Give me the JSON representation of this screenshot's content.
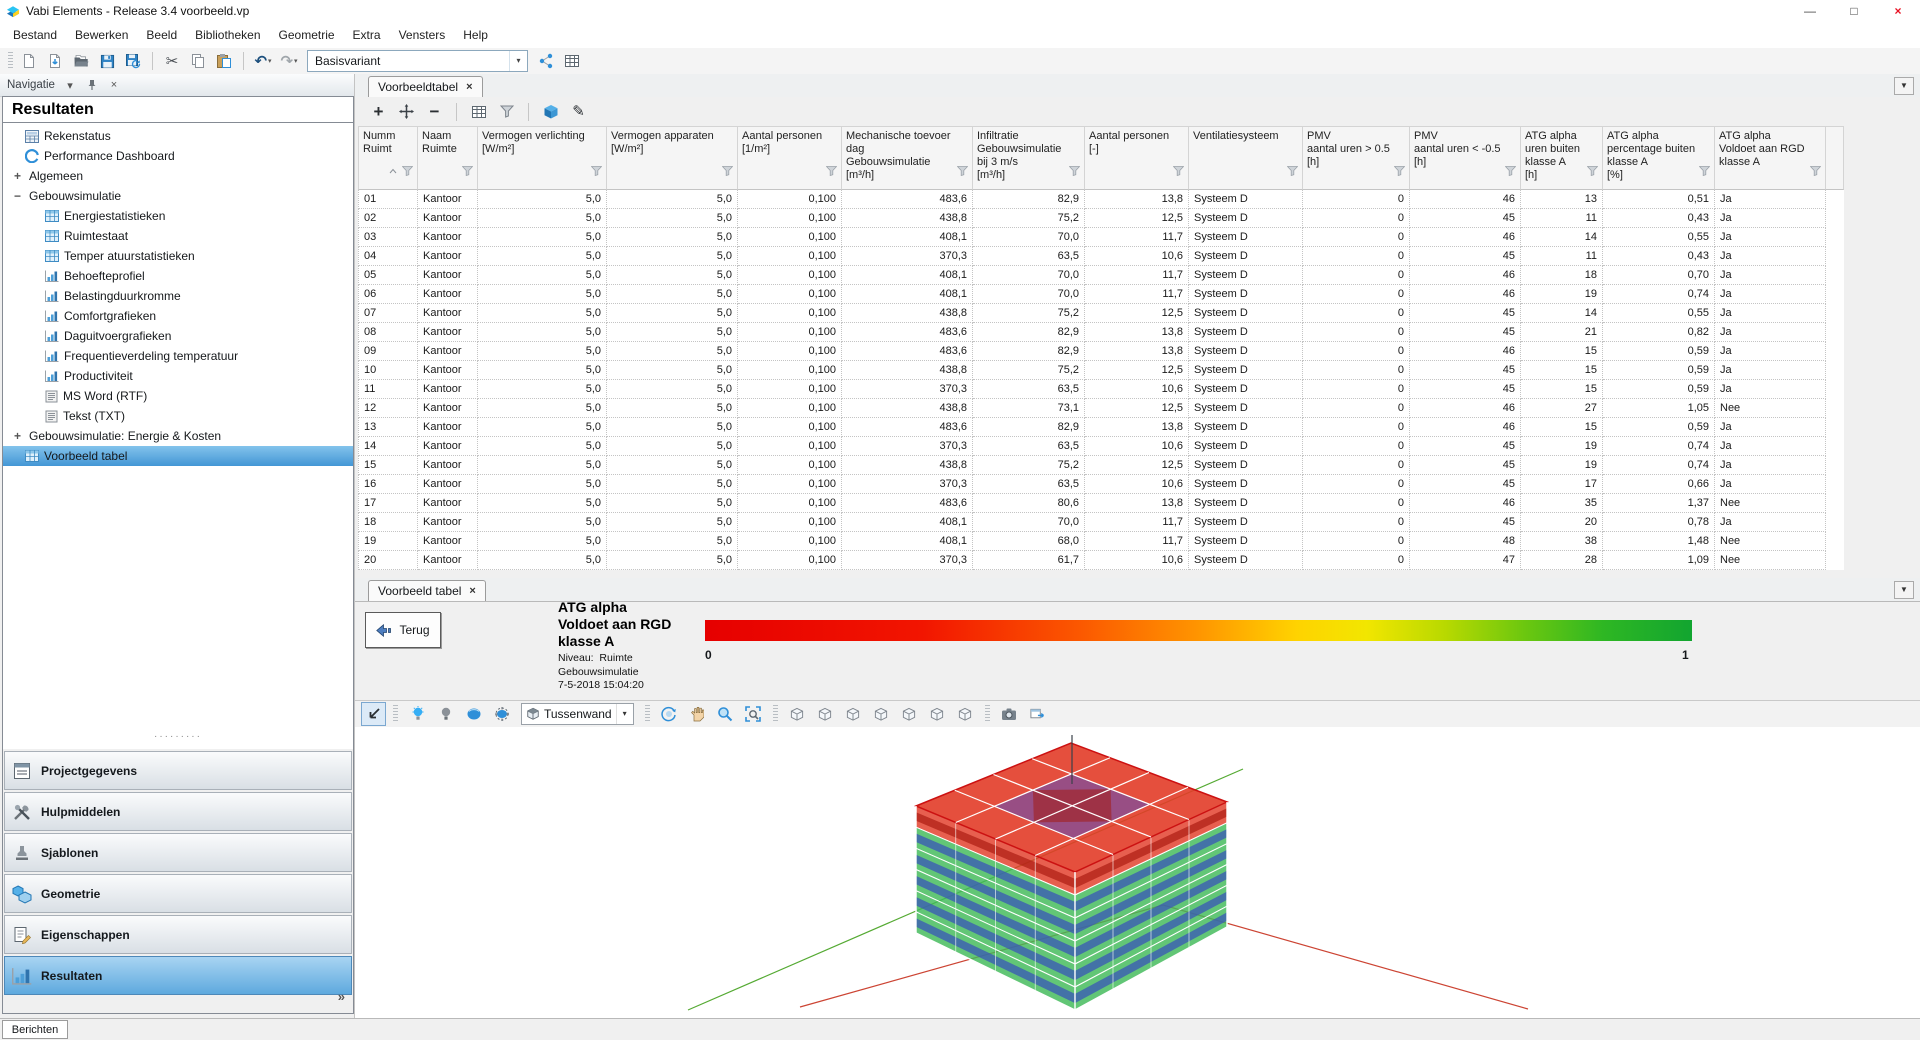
{
  "window": {
    "title": "Vabi Elements - Release 3.4 voorbeeld.vp"
  },
  "window_controls": {
    "minimize": "—",
    "maximize": "□",
    "close": "×"
  },
  "menu": {
    "items": [
      "Bestand",
      "Bewerken",
      "Beeld",
      "Bibliotheken",
      "Geometrie",
      "Extra",
      "Vensters",
      "Help"
    ]
  },
  "toolbar": {
    "buttons": [
      {
        "icon": "new-file"
      },
      {
        "icon": "import-file"
      },
      {
        "icon": "open-folder"
      },
      {
        "icon": "save"
      },
      {
        "icon": "save-refresh"
      },
      {
        "sep": true
      },
      {
        "icon": "cut"
      },
      {
        "icon": "copy"
      },
      {
        "icon": "paste"
      },
      {
        "sep": true
      },
      {
        "icon": "undo",
        "dropdown": true
      },
      {
        "icon": "redo",
        "dropdown": true
      }
    ],
    "variant_value": "Basisvariant",
    "right_buttons": [
      {
        "icon": "share"
      },
      {
        "icon": "table-tool"
      }
    ]
  },
  "sidebar": {
    "panel_title": "Navigatie",
    "section_title": "Resultaten",
    "tree": [
      {
        "label": "Rekenstatus",
        "icon": "calc",
        "indent": 1
      },
      {
        "label": "Performance Dashboard",
        "icon": "gauge",
        "indent": 1
      },
      {
        "label": "Algemeen",
        "expander": "+",
        "indent": 0
      },
      {
        "label": "Gebouwsimulatie",
        "expander": "−",
        "indent": 0
      },
      {
        "label": "Energiestatistieken",
        "icon": "tree-table",
        "indent": 2
      },
      {
        "label": "Ruimtestaat",
        "icon": "tree-table",
        "indent": 2
      },
      {
        "label": "Temper atuurstatistieken",
        "icon": "tree-table",
        "indent": 2
      },
      {
        "label": "Behoefteprofiel",
        "icon": "tree-chart",
        "indent": 2
      },
      {
        "label": "Belastingduurkromme",
        "icon": "tree-chart",
        "indent": 2
      },
      {
        "label": "Comfortgrafieken",
        "icon": "tree-chart",
        "indent": 2
      },
      {
        "label": "Daguitvoergrafieken",
        "icon": "tree-chart",
        "indent": 2
      },
      {
        "label": "Frequentieverdeling temperatuur",
        "icon": "tree-chart",
        "indent": 2
      },
      {
        "label": "Productiviteit",
        "icon": "tree-chart",
        "indent": 2
      },
      {
        "label": "MS Word (RTF)",
        "icon": "tree-doc",
        "indent": 2
      },
      {
        "label": "Tekst (TXT)",
        "icon": "tree-doc",
        "indent": 2
      },
      {
        "label": "Gebouwsimulatie: Energie &  Kosten",
        "expander": "+",
        "indent": 0
      },
      {
        "label": "Voorbeeld tabel",
        "icon": "tree-table",
        "indent": 1,
        "selected": true
      }
    ],
    "nav_buttons": [
      {
        "label": "Projectgegevens",
        "icon": "form"
      },
      {
        "label": "Hulpmiddelen",
        "icon": "tools"
      },
      {
        "label": "Sjablonen",
        "icon": "stamp"
      },
      {
        "label": "Geometrie",
        "icon": "geometry"
      },
      {
        "label": "Eigenschappen",
        "icon": "properties"
      },
      {
        "label": "Resultaten",
        "icon": "results-chart",
        "active": true
      }
    ]
  },
  "table_view": {
    "tab_label": "Voorbeeldtabel",
    "toolbar": [
      {
        "icon": "add"
      },
      {
        "icon": "fit"
      },
      {
        "icon": "remove"
      },
      {
        "sep": true
      },
      {
        "icon": "table-grid"
      },
      {
        "icon": "filter-funnel"
      },
      {
        "sep": true
      },
      {
        "icon": "cube-3d"
      },
      {
        "icon": "edit-pencil"
      }
    ],
    "columns": [
      {
        "lines": [
          "Numm",
          "Ruimt"
        ]
      },
      {
        "lines": [
          "Naam",
          "Ruimte"
        ]
      },
      {
        "lines": [
          "Vermogen verlichting",
          "[W/m²]"
        ]
      },
      {
        "lines": [
          "Vermogen apparaten",
          "[W/m²]"
        ]
      },
      {
        "lines": [
          "Aantal personen",
          "[1/m²]"
        ]
      },
      {
        "lines": [
          "Mechanische toevoer",
          "dag",
          "Gebouwsimulatie",
          "[m³/h]"
        ]
      },
      {
        "lines": [
          "Infiltratie",
          "Gebouwsimulatie",
          "bij 3 m/s",
          "[m³/h]"
        ]
      },
      {
        "lines": [
          "Aantal personen",
          "[-]"
        ]
      },
      {
        "lines": [
          "Ventilatiesysteem"
        ]
      },
      {
        "lines": [
          "PMV",
          "aantal uren > 0.5",
          "[h]"
        ]
      },
      {
        "lines": [
          "PMV",
          "aantal uren < -0.5",
          "[h]"
        ]
      },
      {
        "lines": [
          "ATG alpha",
          "uren buiten",
          "klasse A",
          "[h]"
        ]
      },
      {
        "lines": [
          "ATG alpha",
          "percentage buiten",
          "klasse A",
          "[%]"
        ]
      },
      {
        "lines": [
          "ATG alpha",
          "Voldoet aan RGD",
          "klasse A"
        ]
      }
    ],
    "rows": [
      [
        "01",
        "Kantoor",
        "5,0",
        "5,0",
        "0,100",
        "483,6",
        "82,9",
        "13,8",
        "Systeem D",
        "0",
        "46",
        "13",
        "0,51",
        "Ja"
      ],
      [
        "02",
        "Kantoor",
        "5,0",
        "5,0",
        "0,100",
        "438,8",
        "75,2",
        "12,5",
        "Systeem D",
        "0",
        "45",
        "11",
        "0,43",
        "Ja"
      ],
      [
        "03",
        "Kantoor",
        "5,0",
        "5,0",
        "0,100",
        "408,1",
        "70,0",
        "11,7",
        "Systeem D",
        "0",
        "46",
        "14",
        "0,55",
        "Ja"
      ],
      [
        "04",
        "Kantoor",
        "5,0",
        "5,0",
        "0,100",
        "370,3",
        "63,5",
        "10,6",
        "Systeem D",
        "0",
        "45",
        "11",
        "0,43",
        "Ja"
      ],
      [
        "05",
        "Kantoor",
        "5,0",
        "5,0",
        "0,100",
        "408,1",
        "70,0",
        "11,7",
        "Systeem D",
        "0",
        "46",
        "18",
        "0,70",
        "Ja"
      ],
      [
        "06",
        "Kantoor",
        "5,0",
        "5,0",
        "0,100",
        "408,1",
        "70,0",
        "11,7",
        "Systeem D",
        "0",
        "46",
        "19",
        "0,74",
        "Ja"
      ],
      [
        "07",
        "Kantoor",
        "5,0",
        "5,0",
        "0,100",
        "438,8",
        "75,2",
        "12,5",
        "Systeem D",
        "0",
        "45",
        "14",
        "0,55",
        "Ja"
      ],
      [
        "08",
        "Kantoor",
        "5,0",
        "5,0",
        "0,100",
        "483,6",
        "82,9",
        "13,8",
        "Systeem D",
        "0",
        "45",
        "21",
        "0,82",
        "Ja"
      ],
      [
        "09",
        "Kantoor",
        "5,0",
        "5,0",
        "0,100",
        "483,6",
        "82,9",
        "13,8",
        "Systeem D",
        "0",
        "46",
        "15",
        "0,59",
        "Ja"
      ],
      [
        "10",
        "Kantoor",
        "5,0",
        "5,0",
        "0,100",
        "438,8",
        "75,2",
        "12,5",
        "Systeem D",
        "0",
        "45",
        "15",
        "0,59",
        "Ja"
      ],
      [
        "11",
        "Kantoor",
        "5,0",
        "5,0",
        "0,100",
        "370,3",
        "63,5",
        "10,6",
        "Systeem D",
        "0",
        "45",
        "15",
        "0,59",
        "Ja"
      ],
      [
        "12",
        "Kantoor",
        "5,0",
        "5,0",
        "0,100",
        "438,8",
        "73,1",
        "12,5",
        "Systeem D",
        "0",
        "46",
        "27",
        "1,05",
        "Nee"
      ],
      [
        "13",
        "Kantoor",
        "5,0",
        "5,0",
        "0,100",
        "483,6",
        "82,9",
        "13,8",
        "Systeem D",
        "0",
        "46",
        "15",
        "0,59",
        "Ja"
      ],
      [
        "14",
        "Kantoor",
        "5,0",
        "5,0",
        "0,100",
        "370,3",
        "63,5",
        "10,6",
        "Systeem D",
        "0",
        "45",
        "19",
        "0,74",
        "Ja"
      ],
      [
        "15",
        "Kantoor",
        "5,0",
        "5,0",
        "0,100",
        "438,8",
        "75,2",
        "12,5",
        "Systeem D",
        "0",
        "45",
        "19",
        "0,74",
        "Ja"
      ],
      [
        "16",
        "Kantoor",
        "5,0",
        "5,0",
        "0,100",
        "370,3",
        "63,5",
        "10,6",
        "Systeem D",
        "0",
        "45",
        "17",
        "0,66",
        "Ja"
      ],
      [
        "17",
        "Kantoor",
        "5,0",
        "5,0",
        "0,100",
        "483,6",
        "80,6",
        "13,8",
        "Systeem D",
        "0",
        "46",
        "35",
        "1,37",
        "Nee"
      ],
      [
        "18",
        "Kantoor",
        "5,0",
        "5,0",
        "0,100",
        "408,1",
        "70,0",
        "11,7",
        "Systeem D",
        "0",
        "45",
        "20",
        "0,78",
        "Ja"
      ],
      [
        "19",
        "Kantoor",
        "5,0",
        "5,0",
        "0,100",
        "408,1",
        "68,0",
        "11,7",
        "Systeem D",
        "0",
        "48",
        "38",
        "1,48",
        "Nee"
      ],
      [
        "20",
        "Kantoor",
        "5,0",
        "5,0",
        "0,100",
        "370,3",
        "61,7",
        "10,6",
        "Systeem D",
        "0",
        "47",
        "28",
        "1,09",
        "Nee"
      ]
    ]
  },
  "detail_view": {
    "tab_label": "Voorbeeld tabel",
    "back_label": "Terug",
    "legend_title_lines": [
      "ATG alpha",
      "Voldoet aan RGD",
      "klasse A"
    ],
    "legend_meta_lines": [
      "Niveau:  Ruimte",
      "Gebouwsimulatie",
      "7-5-2018 15:04:20"
    ],
    "scale_min": "0",
    "scale_max": "1",
    "gradient_stops": [
      "#e60000 0%",
      "#f21500 22%",
      "#fb5800 38%",
      "#ff9500 50%",
      "#ffd300 60%",
      "#f2e600 67%",
      "#b8d900 75%",
      "#6cc70f 83%",
      "#2eb723 91%",
      "#12a530 100%"
    ]
  },
  "viewport3d": {
    "wall_filter_value": "Tussenwand",
    "toolbar": [
      {
        "icon": "select-arrow",
        "active": true
      },
      {
        "sep": true
      },
      {
        "icon": "light-on"
      },
      {
        "icon": "light-off"
      },
      {
        "icon": "render-solid"
      },
      {
        "icon": "render-target"
      },
      {
        "combo": true
      },
      {
        "sep": true
      },
      {
        "icon": "orbit"
      },
      {
        "icon": "pan-hand"
      },
      {
        "icon": "zoom"
      },
      {
        "icon": "zoom-window"
      },
      {
        "sep": true
      },
      {
        "icon": "view-cube-1"
      },
      {
        "icon": "view-cube-2"
      },
      {
        "icon": "view-cube-3"
      },
      {
        "icon": "view-cube-4"
      },
      {
        "icon": "view-cube-5"
      },
      {
        "icon": "view-cube-6"
      },
      {
        "icon": "view-cube-7"
      },
      {
        "sep": true
      },
      {
        "icon": "screenshot"
      },
      {
        "icon": "export-view"
      }
    ]
  },
  "statusbar": {
    "messages_tab": "Berichten"
  }
}
